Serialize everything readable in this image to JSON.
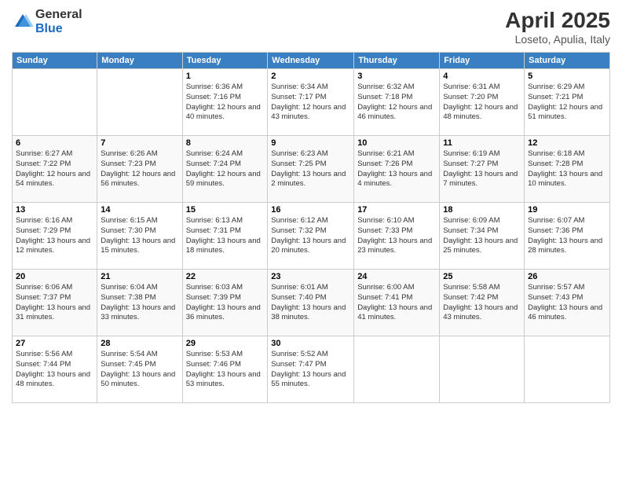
{
  "logo": {
    "general": "General",
    "blue": "Blue"
  },
  "title": "April 2025",
  "location": "Loseto, Apulia, Italy",
  "days_of_week": [
    "Sunday",
    "Monday",
    "Tuesday",
    "Wednesday",
    "Thursday",
    "Friday",
    "Saturday"
  ],
  "weeks": [
    [
      {
        "day": "",
        "info": ""
      },
      {
        "day": "",
        "info": ""
      },
      {
        "day": "1",
        "info": "Sunrise: 6:36 AM\nSunset: 7:16 PM\nDaylight: 12 hours and 40 minutes."
      },
      {
        "day": "2",
        "info": "Sunrise: 6:34 AM\nSunset: 7:17 PM\nDaylight: 12 hours and 43 minutes."
      },
      {
        "day": "3",
        "info": "Sunrise: 6:32 AM\nSunset: 7:18 PM\nDaylight: 12 hours and 46 minutes."
      },
      {
        "day": "4",
        "info": "Sunrise: 6:31 AM\nSunset: 7:20 PM\nDaylight: 12 hours and 48 minutes."
      },
      {
        "day": "5",
        "info": "Sunrise: 6:29 AM\nSunset: 7:21 PM\nDaylight: 12 hours and 51 minutes."
      }
    ],
    [
      {
        "day": "6",
        "info": "Sunrise: 6:27 AM\nSunset: 7:22 PM\nDaylight: 12 hours and 54 minutes."
      },
      {
        "day": "7",
        "info": "Sunrise: 6:26 AM\nSunset: 7:23 PM\nDaylight: 12 hours and 56 minutes."
      },
      {
        "day": "8",
        "info": "Sunrise: 6:24 AM\nSunset: 7:24 PM\nDaylight: 12 hours and 59 minutes."
      },
      {
        "day": "9",
        "info": "Sunrise: 6:23 AM\nSunset: 7:25 PM\nDaylight: 13 hours and 2 minutes."
      },
      {
        "day": "10",
        "info": "Sunrise: 6:21 AM\nSunset: 7:26 PM\nDaylight: 13 hours and 4 minutes."
      },
      {
        "day": "11",
        "info": "Sunrise: 6:19 AM\nSunset: 7:27 PM\nDaylight: 13 hours and 7 minutes."
      },
      {
        "day": "12",
        "info": "Sunrise: 6:18 AM\nSunset: 7:28 PM\nDaylight: 13 hours and 10 minutes."
      }
    ],
    [
      {
        "day": "13",
        "info": "Sunrise: 6:16 AM\nSunset: 7:29 PM\nDaylight: 13 hours and 12 minutes."
      },
      {
        "day": "14",
        "info": "Sunrise: 6:15 AM\nSunset: 7:30 PM\nDaylight: 13 hours and 15 minutes."
      },
      {
        "day": "15",
        "info": "Sunrise: 6:13 AM\nSunset: 7:31 PM\nDaylight: 13 hours and 18 minutes."
      },
      {
        "day": "16",
        "info": "Sunrise: 6:12 AM\nSunset: 7:32 PM\nDaylight: 13 hours and 20 minutes."
      },
      {
        "day": "17",
        "info": "Sunrise: 6:10 AM\nSunset: 7:33 PM\nDaylight: 13 hours and 23 minutes."
      },
      {
        "day": "18",
        "info": "Sunrise: 6:09 AM\nSunset: 7:34 PM\nDaylight: 13 hours and 25 minutes."
      },
      {
        "day": "19",
        "info": "Sunrise: 6:07 AM\nSunset: 7:36 PM\nDaylight: 13 hours and 28 minutes."
      }
    ],
    [
      {
        "day": "20",
        "info": "Sunrise: 6:06 AM\nSunset: 7:37 PM\nDaylight: 13 hours and 31 minutes."
      },
      {
        "day": "21",
        "info": "Sunrise: 6:04 AM\nSunset: 7:38 PM\nDaylight: 13 hours and 33 minutes."
      },
      {
        "day": "22",
        "info": "Sunrise: 6:03 AM\nSunset: 7:39 PM\nDaylight: 13 hours and 36 minutes."
      },
      {
        "day": "23",
        "info": "Sunrise: 6:01 AM\nSunset: 7:40 PM\nDaylight: 13 hours and 38 minutes."
      },
      {
        "day": "24",
        "info": "Sunrise: 6:00 AM\nSunset: 7:41 PM\nDaylight: 13 hours and 41 minutes."
      },
      {
        "day": "25",
        "info": "Sunrise: 5:58 AM\nSunset: 7:42 PM\nDaylight: 13 hours and 43 minutes."
      },
      {
        "day": "26",
        "info": "Sunrise: 5:57 AM\nSunset: 7:43 PM\nDaylight: 13 hours and 46 minutes."
      }
    ],
    [
      {
        "day": "27",
        "info": "Sunrise: 5:56 AM\nSunset: 7:44 PM\nDaylight: 13 hours and 48 minutes."
      },
      {
        "day": "28",
        "info": "Sunrise: 5:54 AM\nSunset: 7:45 PM\nDaylight: 13 hours and 50 minutes."
      },
      {
        "day": "29",
        "info": "Sunrise: 5:53 AM\nSunset: 7:46 PM\nDaylight: 13 hours and 53 minutes."
      },
      {
        "day": "30",
        "info": "Sunrise: 5:52 AM\nSunset: 7:47 PM\nDaylight: 13 hours and 55 minutes."
      },
      {
        "day": "",
        "info": ""
      },
      {
        "day": "",
        "info": ""
      },
      {
        "day": "",
        "info": ""
      }
    ]
  ]
}
